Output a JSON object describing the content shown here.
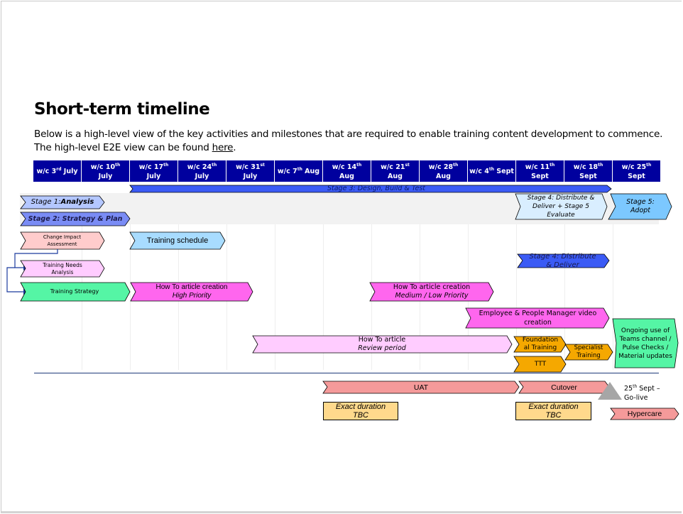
{
  "page": {
    "title": "Short-term timeline",
    "description_line1": "Below is a high-level view of the key activities and milestones that are required to enable training content development to commence.",
    "description_line2_prefix": "The high-level E2E view can be found ",
    "description_link": "here",
    "description_line2_suffix": "."
  },
  "colors": {
    "header_bg": "#00009e",
    "stage_band": "#f2f2f2",
    "stage1": "#b4c7ff",
    "stage2": "#7a8cf5",
    "stage3": "#3b5bf5",
    "stage4": "#d9eeff",
    "stage5": "#7cc8ff",
    "change_impact": "#ffcccc",
    "training_needs": "#ffccff",
    "training_strategy": "#55f5a5",
    "training_schedule": "#a8dcff",
    "how_to": "#ff66ee",
    "review": "#ffccff",
    "orange": "#f5a800",
    "uat": "#f59a9a",
    "tbc_box": "#ffd98c",
    "milestone": "#a6a6a6"
  },
  "weeks": [
    {
      "prefix": "w/c 3",
      "sup": "rd",
      "suffix": " July",
      "second": ""
    },
    {
      "prefix": "w/c 10",
      "sup": "th",
      "suffix": "",
      "second": "July"
    },
    {
      "prefix": "w/c 17",
      "sup": "th",
      "suffix": "",
      "second": "July"
    },
    {
      "prefix": "w/c 24",
      "sup": "th",
      "suffix": "",
      "second": "July"
    },
    {
      "prefix": "w/c 31",
      "sup": "st",
      "suffix": "",
      "second": "July"
    },
    {
      "prefix": "w/c 7",
      "sup": "th",
      "suffix": " Aug",
      "second": ""
    },
    {
      "prefix": "w/c 14",
      "sup": "th",
      "suffix": "",
      "second": "Aug"
    },
    {
      "prefix": "w/c 21",
      "sup": "st",
      "suffix": "",
      "second": "Aug"
    },
    {
      "prefix": "w/c 28",
      "sup": "th",
      "suffix": "",
      "second": "Aug"
    },
    {
      "prefix": "w/c 4",
      "sup": "th",
      "suffix": " Sept",
      "second": ""
    },
    {
      "prefix": "w/c 11",
      "sup": "th",
      "suffix": "",
      "second": "Sept"
    },
    {
      "prefix": "w/c 18",
      "sup": "th",
      "suffix": "",
      "second": "Sept"
    },
    {
      "prefix": "w/c 25",
      "sup": "th",
      "suffix": "",
      "second": "Sept"
    }
  ],
  "stages": {
    "stage1_prefix": "Stage 1: ",
    "stage1_name": "Analysis",
    "stage2": "Stage 2: Strategy & Plan",
    "stage3": "Stage 3: Design, Build & Test",
    "stage4_5": "Stage 4: Distribute & Deliver + Stage 5 Evaluate",
    "stage5": "Stage 5: Adopt",
    "stage4": "Stage 4: Distribute & Deliver"
  },
  "activities": {
    "change_impact": "Change Impact Assessment",
    "training_needs": "Training Needs Analysis",
    "training_strategy": "Training Strategy",
    "training_schedule": "Training schedule",
    "howto_high_1": "How To article creation",
    "howto_high_2": "High Priority",
    "howto_med_1": "How To article creation",
    "howto_med_2": "Medium / Low Priority",
    "video": "Employee & People Manager video creation",
    "review_1": "How To article",
    "review_2": "Review period",
    "foundational": "Foundation al Training",
    "ttt": "TTT",
    "specialist": "Specialist Training",
    "ongoing": "Ongoing use of Teams channel / Pulse Checks / Material updates"
  },
  "milestones": {
    "uat": "UAT",
    "cutover": "Cutover",
    "uat_tbc_1": "Exact duration",
    "uat_tbc_2": "TBC",
    "cutover_tbc_1": "Exact duration",
    "cutover_tbc_2": "TBC",
    "golive_prefix": "25",
    "golive_sup": "th",
    "golive_suffix": " Sept –",
    "golive_line2": "Go-live",
    "hypercare": "Hypercare"
  }
}
